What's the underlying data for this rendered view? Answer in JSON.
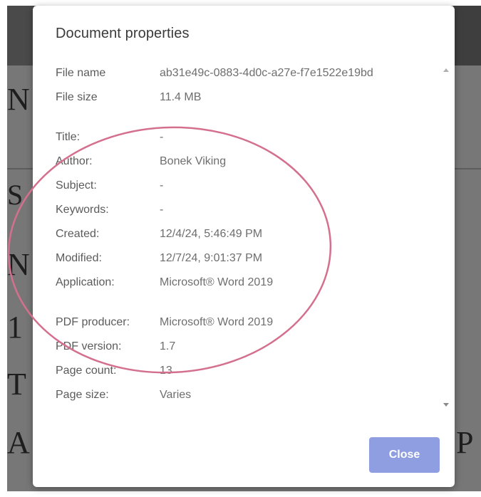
{
  "dialog": {
    "title": "Document properties",
    "close_label": "Close"
  },
  "properties": [
    {
      "key": "File name",
      "value": "ab31e49c-0883-4d0c-a27e-f7e1522e19bd"
    },
    {
      "key": "File size",
      "value": "11.4 MB"
    },
    {
      "key": "Title:",
      "value": "-"
    },
    {
      "key": "Author:",
      "value": "Bonek Viking"
    },
    {
      "key": "Subject:",
      "value": "-"
    },
    {
      "key": "Keywords:",
      "value": "-"
    },
    {
      "key": "Created:",
      "value": "12/4/24, 5:46:49 PM"
    },
    {
      "key": "Modified:",
      "value": "12/7/24, 9:01:37 PM"
    },
    {
      "key": "Application:",
      "value": "Microsoft® Word 2019"
    },
    {
      "key": "PDF producer:",
      "value": "Microsoft® Word 2019"
    },
    {
      "key": "PDF version:",
      "value": "1.7"
    },
    {
      "key": "Page count:",
      "value": "13"
    },
    {
      "key": "Page size:",
      "value": "Varies"
    }
  ],
  "background_letters": [
    "N",
    "S",
    "N",
    "1",
    "T",
    "A",
    "P"
  ],
  "colors": {
    "accent_button": "#8f9ee0",
    "annotation_ellipse": "#d4708e",
    "backdrop": "#777777"
  },
  "icons": [
    "scroll-up-arrow-icon",
    "scroll-down-arrow-icon"
  ]
}
